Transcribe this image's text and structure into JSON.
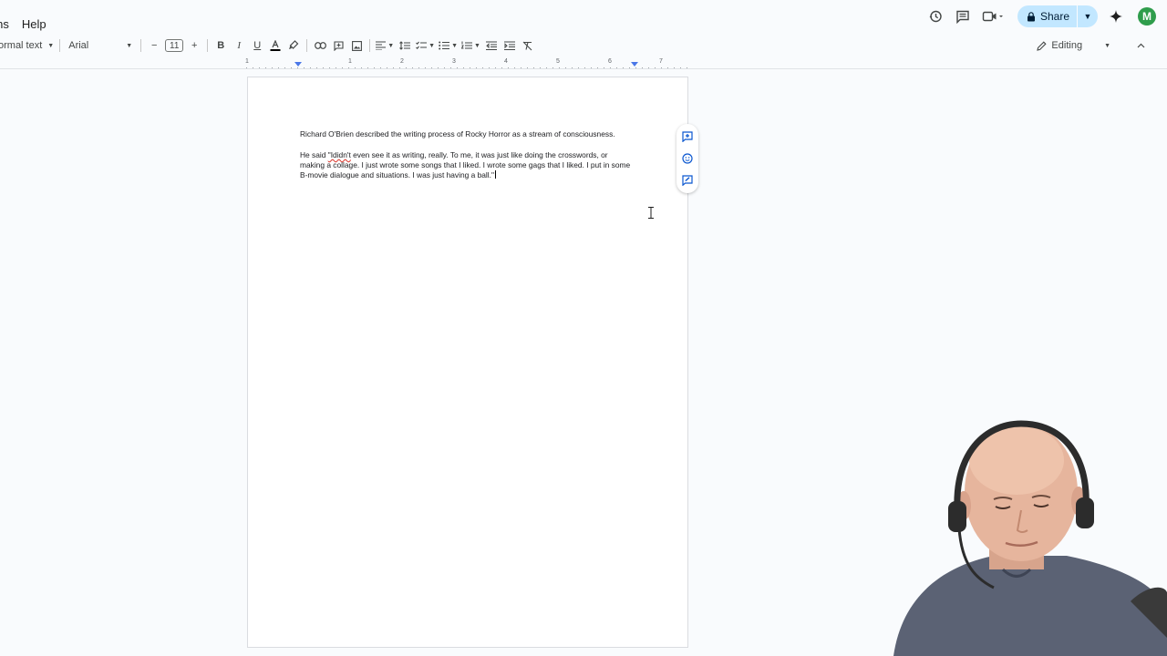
{
  "menubar": {
    "items": [
      "ions",
      "Help"
    ]
  },
  "topright": {
    "history_icon": "history-icon",
    "comments_icon": "comment-icon",
    "meet_icon": "video-camera-icon",
    "share_label": "Share",
    "gemini_icon": "sparkle-icon",
    "avatar_initial": "M"
  },
  "toolbar": {
    "style_value": "ormal text",
    "font_value": "Arial",
    "font_size": "11",
    "mode_label": "Editing"
  },
  "ruler": {
    "numbers": [
      "1",
      "1",
      "2",
      "3",
      "4",
      "5",
      "6",
      "7"
    ]
  },
  "document": {
    "para1": "Richard O'Brien described the writing process of Rocky Horror as a stream of consciousness.",
    "para2_before": "He said ",
    "para2_flagged": "\"Ididn't",
    "para2_after": " even see it as writing, really. To me, it was just like doing the crosswords, or making a collage. I just wrote some songs that I liked. I wrote some gags that I liked. I put in some B-movie dialogue and situations. I was just having a ball.\""
  },
  "colors": {
    "share_bg": "#c2e7ff",
    "avatar_bg": "#2f9d4c",
    "accent": "#4a77e8"
  }
}
